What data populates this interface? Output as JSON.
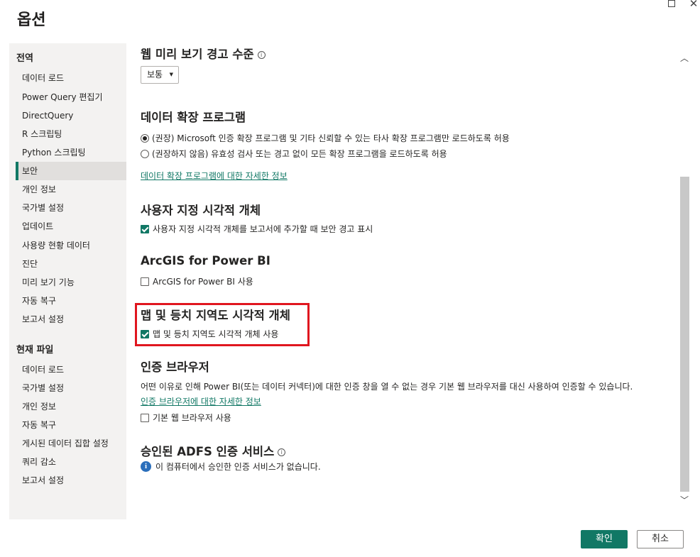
{
  "dialog": {
    "title": "옵션"
  },
  "sidebar": {
    "global_heading": "전역",
    "global_items": [
      {
        "label": "데이터 로드"
      },
      {
        "label": "Power Query 편집기"
      },
      {
        "label": "DirectQuery"
      },
      {
        "label": "R 스크립팅"
      },
      {
        "label": "Python 스크립팅"
      },
      {
        "label": "보안",
        "selected": true
      },
      {
        "label": "개인 정보"
      },
      {
        "label": "국가별 설정"
      },
      {
        "label": "업데이트"
      },
      {
        "label": "사용량 현황 데이터"
      },
      {
        "label": "진단"
      },
      {
        "label": "미리 보기 기능"
      },
      {
        "label": "자동 복구"
      },
      {
        "label": "보고서 설정"
      }
    ],
    "file_heading": "현재 파일",
    "file_items": [
      {
        "label": "데이터 로드"
      },
      {
        "label": "국가별 설정"
      },
      {
        "label": "개인 정보"
      },
      {
        "label": "자동 복구"
      },
      {
        "label": "게시된 데이터 집합 설정"
      },
      {
        "label": "쿼리 감소"
      },
      {
        "label": "보고서 설정"
      }
    ]
  },
  "web_preview": {
    "title": "웹 미리 보기 경고 수준",
    "dropdown_value": "보통"
  },
  "data_extensions": {
    "title": "데이터 확장 프로그램",
    "option_recommended": "(권장) Microsoft 인증 확장 프로그램 및 기타 신뢰할 수 있는 타사 확장 프로그램만 로드하도록 허용",
    "option_not_recommended": "(권장하지 않음) 유효성 검사 또는 경고 없이 모든 확장 프로그램을 로드하도록 허용",
    "selected": "recommended",
    "link": "데이터 확장 프로그램에 대한 자세한 정보"
  },
  "custom_visuals": {
    "title": "사용자 지정 시각적 개체",
    "checkbox_label": "사용자 지정 시각적 개체를 보고서에 추가할 때 보안 경고 표시",
    "checked": true
  },
  "arcgis": {
    "title": "ArcGIS for Power BI",
    "checkbox_label": "ArcGIS for Power BI 사용",
    "checked": false
  },
  "maps": {
    "title": "맵 및 등치 지역도 시각적 개체",
    "checkbox_label": "맵 및 등치 지역도 시각적 개체 사용",
    "checked": true,
    "highlight_color": "#e0161f"
  },
  "auth_browser": {
    "title": "인증 브라우저",
    "description": "어떤 이유로 인해 Power BI(또는 데이터 커넥터)에 대한 인증 창을 열 수 없는 경우 기본 웹 브라우저를 대신 사용하여 인증할 수 있습니다.",
    "link": "인증 브라우저에 대한 자세한 정보",
    "checkbox_label": "기본 웹 브라우저 사용",
    "checked": false
  },
  "adfs": {
    "title": "승인된 ADFS 인증 서비스",
    "message": "이 컴퓨터에서 승인한 인증 서비스가 없습니다."
  },
  "footer": {
    "ok_label": "확인",
    "cancel_label": "취소"
  },
  "colors": {
    "accent": "#117865",
    "info": "#2a6ebb"
  }
}
